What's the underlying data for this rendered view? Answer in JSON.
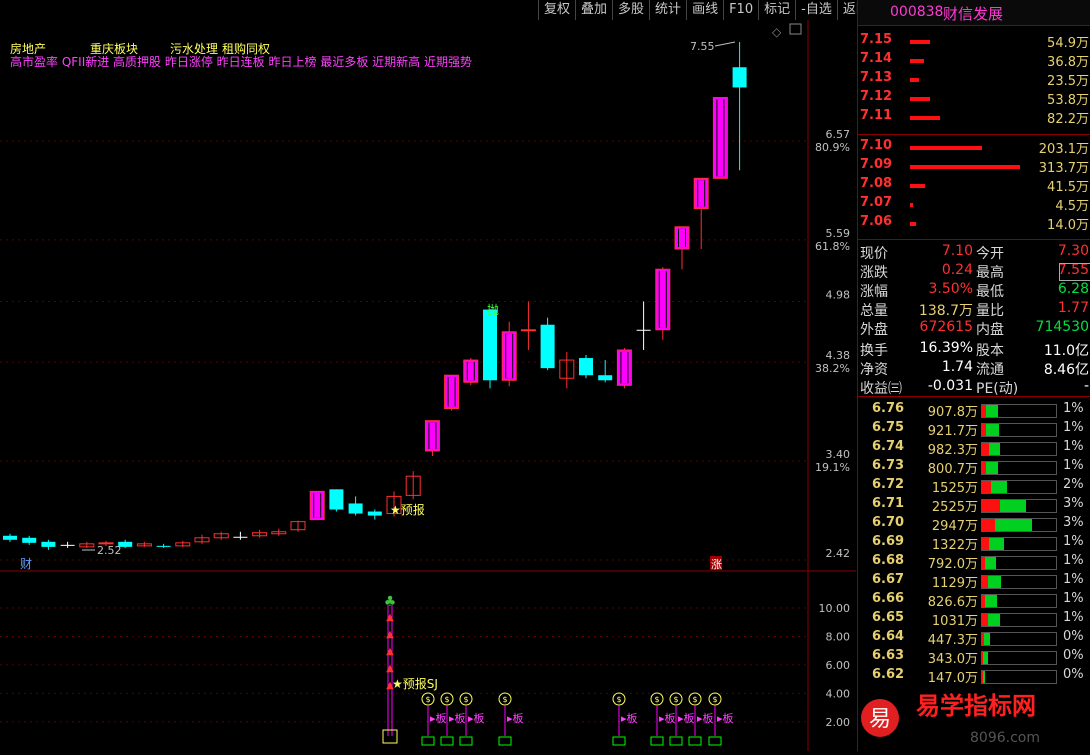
{
  "toolbar": [
    "复权",
    "叠加",
    "多股",
    "统计",
    "画线",
    "F10",
    "标记",
    "-自选",
    "返回"
  ],
  "header": {
    "code": "000838",
    "name": "财信发展"
  },
  "chart": {
    "concepts_row1": [
      "房地产",
      "重庆板块",
      "污水处理",
      "租购同权"
    ],
    "concepts_row2": "高市盈率 QFII新进 高质押股 昨日涨停 昨日连板 昨日上榜 最近多板 近期新高 近期强势",
    "price_axis": [
      {
        "v": "6.57",
        "pct": "80.9%"
      },
      {
        "v": "5.59",
        "pct": "61.8%"
      },
      {
        "v": "4.98",
        "pct": ""
      },
      {
        "v": "4.38",
        "pct": "38.2%"
      },
      {
        "v": "3.40",
        "pct": "19.1%"
      },
      {
        "v": "2.42",
        "pct": ""
      }
    ],
    "high_label": "7.55",
    "low_label": "2.52",
    "throw_label": "抛",
    "forecast_label": "预报",
    "cai_label": "财",
    "zhang_label": "涨",
    "sub_axis": [
      "10.00",
      "8.00",
      "6.00",
      "4.00",
      "2.00"
    ],
    "sub_forecast": "预报SJ",
    "ban_label": "板"
  },
  "sells": [
    {
      "p": "7.15",
      "q": "54.9万",
      "w": 20
    },
    {
      "p": "7.14",
      "q": "36.8万",
      "w": 14
    },
    {
      "p": "7.13",
      "q": "23.5万",
      "w": 9
    },
    {
      "p": "7.12",
      "q": "53.8万",
      "w": 20
    },
    {
      "p": "7.11",
      "q": "82.2万",
      "w": 30
    }
  ],
  "buys": [
    {
      "p": "7.10",
      "q": "203.1万",
      "w": 72
    },
    {
      "p": "7.09",
      "q": "313.7万",
      "w": 110
    },
    {
      "p": "7.08",
      "q": "41.5万",
      "w": 15
    },
    {
      "p": "7.07",
      "q": "4.5万",
      "w": 3
    },
    {
      "p": "7.06",
      "q": "14.0万",
      "w": 6
    }
  ],
  "stats": {
    "xj_l": "现价",
    "xj": "7.10",
    "jk_l": "今开",
    "jk": "7.30",
    "zd_l": "涨跌",
    "zd": "0.24",
    "zg_l": "最高",
    "zg": "7.55",
    "zf_l": "涨幅",
    "zf": "3.50%",
    "zdi_l": "最低",
    "zdi": "6.28",
    "zl_l": "总量",
    "zl": "138.7万",
    "lb_l": "量比",
    "lb": "1.77",
    "wp_l": "外盘",
    "wp": "672615",
    "np_l": "内盘",
    "np": "714530",
    "hs_l": "换手",
    "hs": "16.39%",
    "gb_l": "股本",
    "gb": "11.0亿",
    "jz_l": "净资",
    "jz": "1.74",
    "lt_l": "流通",
    "lt": "8.46亿",
    "sy_l": "收益㈢",
    "sy": "-0.031",
    "pe_l": "PE(动)",
    "pe": "-"
  },
  "volume_profile": [
    {
      "p": "6.76",
      "v": "907.8万",
      "r": 0.05,
      "g": 0.17,
      "pct": "1%"
    },
    {
      "p": "6.75",
      "v": "921.7万",
      "r": 0.05,
      "g": 0.18,
      "pct": "1%"
    },
    {
      "p": "6.74",
      "v": "982.3万",
      "r": 0.1,
      "g": 0.14,
      "pct": "1%"
    },
    {
      "p": "6.73",
      "v": "800.7万",
      "r": 0.05,
      "g": 0.16,
      "pct": "1%"
    },
    {
      "p": "6.72",
      "v": "1525万",
      "r": 0.12,
      "g": 0.22,
      "pct": "2%"
    },
    {
      "p": "6.71",
      "v": "2525万",
      "r": 0.24,
      "g": 0.35,
      "pct": "3%"
    },
    {
      "p": "6.70",
      "v": "2947万",
      "r": 0.18,
      "g": 0.5,
      "pct": "3%"
    },
    {
      "p": "6.69",
      "v": "1322万",
      "r": 0.1,
      "g": 0.2,
      "pct": "1%"
    },
    {
      "p": "6.68",
      "v": "792.0万",
      "r": 0.04,
      "g": 0.15,
      "pct": "1%"
    },
    {
      "p": "6.67",
      "v": "1129万",
      "r": 0.08,
      "g": 0.18,
      "pct": "1%"
    },
    {
      "p": "6.66",
      "v": "826.6万",
      "r": 0.04,
      "g": 0.16,
      "pct": "1%"
    },
    {
      "p": "6.65",
      "v": "1031万",
      "r": 0.08,
      "g": 0.16,
      "pct": "1%"
    },
    {
      "p": "6.64",
      "v": "447.3万",
      "r": 0.03,
      "g": 0.08,
      "pct": "0%"
    },
    {
      "p": "6.63",
      "v": "343.0万",
      "r": 0.02,
      "g": 0.06,
      "pct": "0%"
    },
    {
      "p": "6.62",
      "v": "147.0万",
      "r": 0.01,
      "g": 0.03,
      "pct": "0%"
    }
  ],
  "watermark": {
    "brand": "易学指标网",
    "url": "8096.com"
  },
  "colors": {
    "up": "#ff3030",
    "down": "#00ffff",
    "limit": "#ff00ff"
  }
}
